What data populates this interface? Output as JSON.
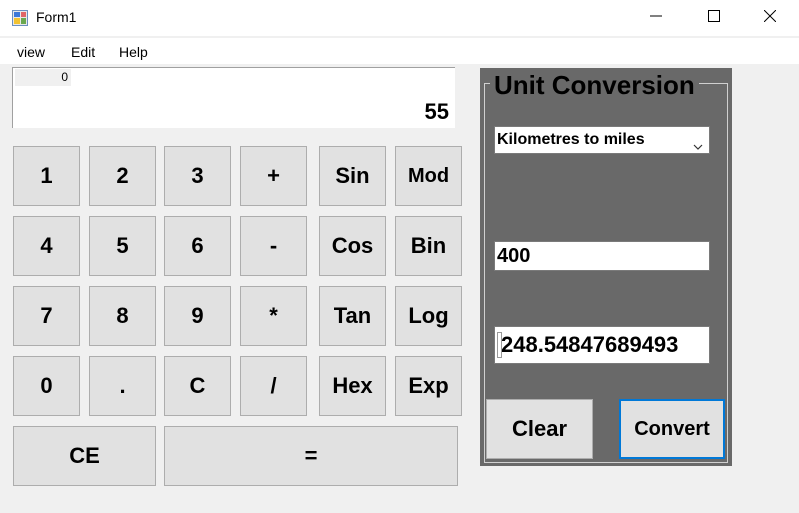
{
  "window": {
    "title": "Form1",
    "controls": {
      "minimize": "minimize-icon",
      "maximize": "maximize-icon",
      "close": "close-icon"
    }
  },
  "menu": [
    "view",
    "Edit",
    "Help"
  ],
  "display": {
    "memory": "0",
    "value": "55"
  },
  "keypad": {
    "row1": [
      "1",
      "2",
      "3",
      "+",
      "Sin",
      "Mod"
    ],
    "row2": [
      "4",
      "5",
      "6",
      "-",
      "Cos",
      "Bin"
    ],
    "row3": [
      "7",
      "8",
      "9",
      "*",
      "Tan",
      "Log"
    ],
    "row4": [
      "0",
      ".",
      "C",
      "/",
      "Hex",
      "Exp"
    ],
    "row5": [
      "CE",
      "="
    ]
  },
  "conversion": {
    "title": "Unit Conversion",
    "selected": "Kilometres to miles",
    "input": "400",
    "output": "248.54847689493",
    "clear_label": "Clear",
    "convert_label": "Convert"
  },
  "colors": {
    "panel": "#696969",
    "key": "#e1e1e1",
    "focus": "#0078d7"
  }
}
